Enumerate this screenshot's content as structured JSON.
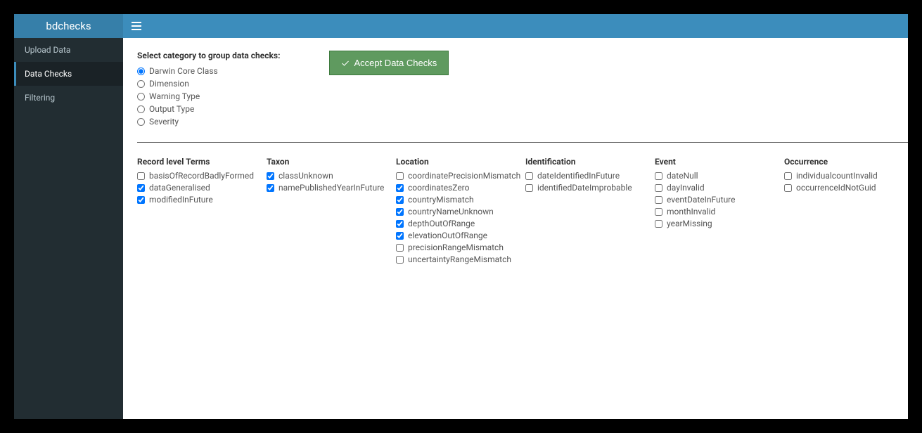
{
  "brand": "bdchecks",
  "nav": [
    {
      "label": "Upload Data",
      "active": false
    },
    {
      "label": "Data Checks",
      "active": true
    },
    {
      "label": "Filtering",
      "active": false
    }
  ],
  "categoryTitle": "Select category to group data checks:",
  "categories": [
    {
      "label": "Darwin Core Class",
      "checked": true
    },
    {
      "label": "Dimension",
      "checked": false
    },
    {
      "label": "Warning Type",
      "checked": false
    },
    {
      "label": "Output Type",
      "checked": false
    },
    {
      "label": "Severity",
      "checked": false
    }
  ],
  "acceptLabel": "Accept Data Checks",
  "groups": [
    {
      "title": "Record level Terms",
      "items": [
        {
          "label": "basisOfRecordBadlyFormed",
          "checked": false
        },
        {
          "label": "dataGeneralised",
          "checked": true
        },
        {
          "label": "modifiedInFuture",
          "checked": true
        }
      ]
    },
    {
      "title": "Taxon",
      "items": [
        {
          "label": "classUnknown",
          "checked": true
        },
        {
          "label": "namePublishedYearInFuture",
          "checked": true
        }
      ]
    },
    {
      "title": "Location",
      "items": [
        {
          "label": "coordinatePrecisionMismatch",
          "checked": false
        },
        {
          "label": "coordinatesZero",
          "checked": true
        },
        {
          "label": "countryMismatch",
          "checked": true
        },
        {
          "label": "countryNameUnknown",
          "checked": true
        },
        {
          "label": "depthOutOfRange",
          "checked": true
        },
        {
          "label": "elevationOutOfRange",
          "checked": true
        },
        {
          "label": "precisionRangeMismatch",
          "checked": false
        },
        {
          "label": "uncertaintyRangeMismatch",
          "checked": false
        }
      ]
    },
    {
      "title": "Identification",
      "items": [
        {
          "label": "dateIdentifiedInFuture",
          "checked": false
        },
        {
          "label": "identifiedDateImprobable",
          "checked": false
        }
      ]
    },
    {
      "title": "Event",
      "items": [
        {
          "label": "dateNull",
          "checked": false
        },
        {
          "label": "dayInvalid",
          "checked": false
        },
        {
          "label": "eventDateInFuture",
          "checked": false
        },
        {
          "label": "monthInvalid",
          "checked": false
        },
        {
          "label": "yearMissing",
          "checked": false
        }
      ]
    },
    {
      "title": "Occurrence",
      "items": [
        {
          "label": "individualcountInvalid",
          "checked": false
        },
        {
          "label": "occurrenceIdNotGuid",
          "checked": false
        }
      ]
    }
  ]
}
